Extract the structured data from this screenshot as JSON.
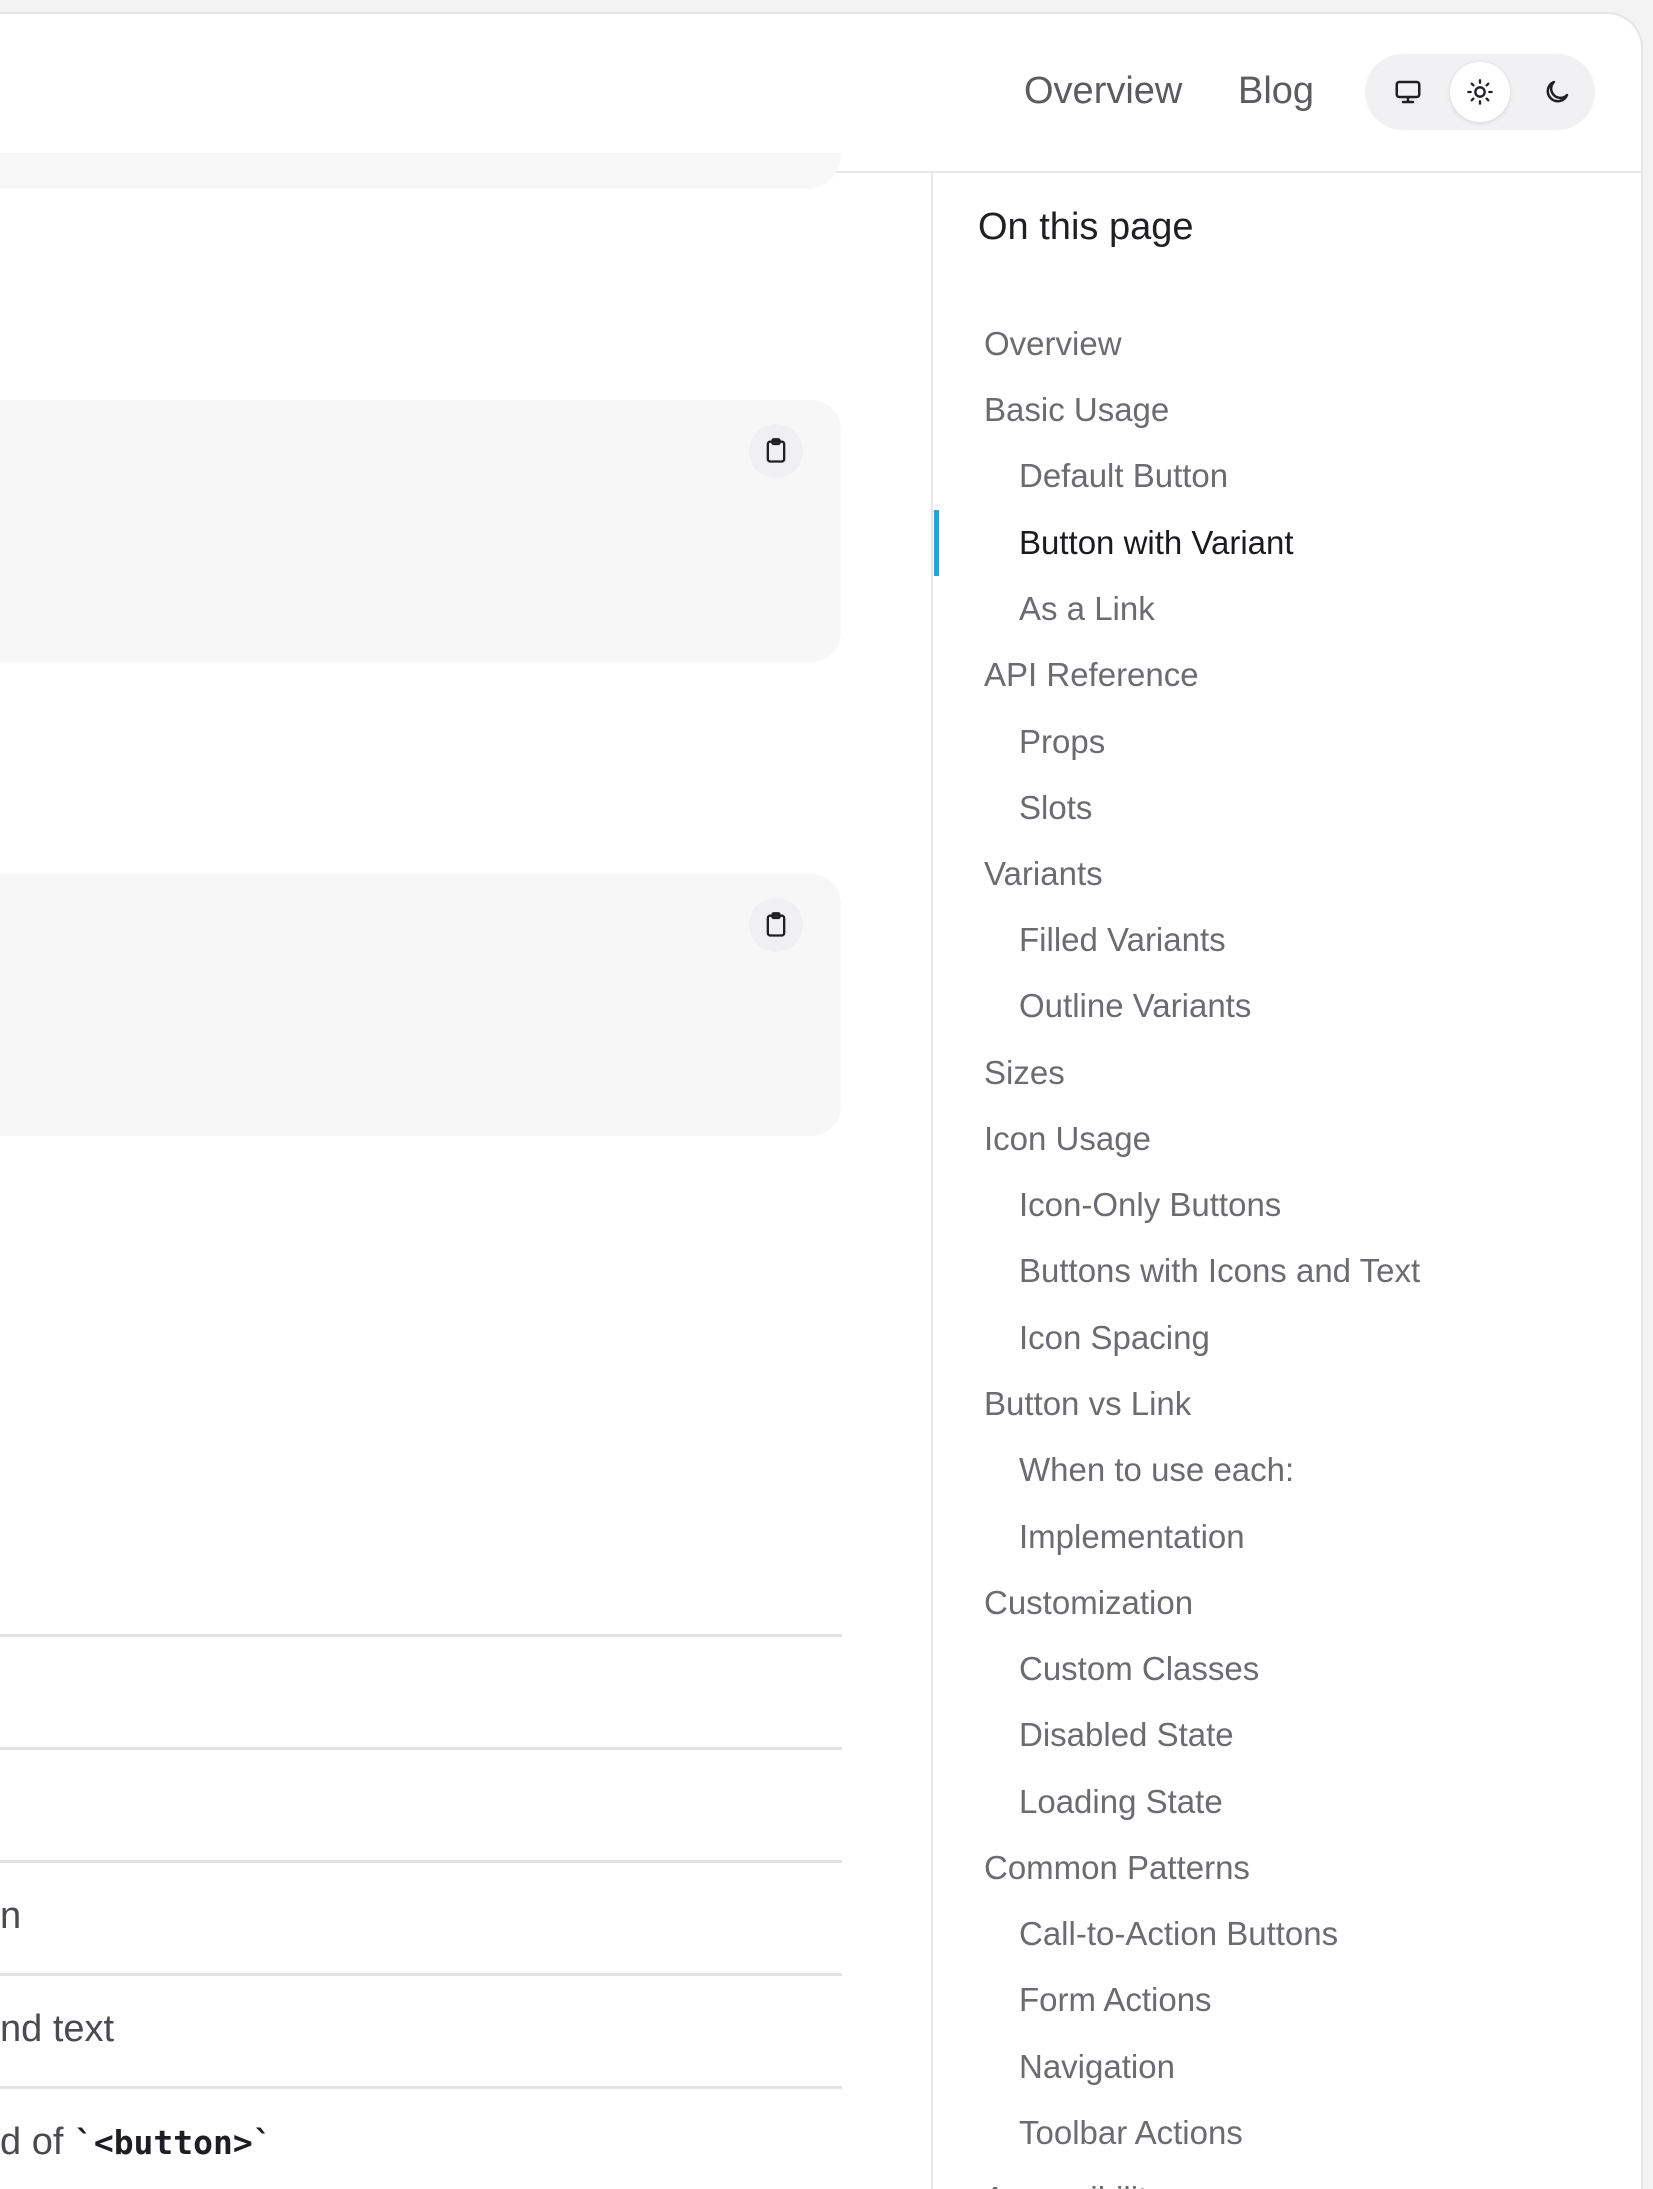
{
  "header": {
    "nav": [
      "Overview",
      "Blog"
    ],
    "theme_options": [
      {
        "icon": "monitor-icon",
        "active": false
      },
      {
        "icon": "sun-icon",
        "active": true
      },
      {
        "icon": "moon-icon",
        "active": false
      }
    ]
  },
  "main": {
    "rows": [
      "",
      "",
      "n",
      "nd text",
      "d of "
    ],
    "row_code": "`<button>`"
  },
  "toc": {
    "title": "On this page",
    "accent_color": "#1ea7e4",
    "items": [
      {
        "label": "Overview",
        "level": 1
      },
      {
        "label": "Basic Usage",
        "level": 1
      },
      {
        "label": "Default Button",
        "level": 2
      },
      {
        "label": "Button with Variant",
        "level": 2,
        "active": true
      },
      {
        "label": "As a Link",
        "level": 2
      },
      {
        "label": "API Reference",
        "level": 1
      },
      {
        "label": "Props",
        "level": 2
      },
      {
        "label": "Slots",
        "level": 2
      },
      {
        "label": "Variants",
        "level": 1
      },
      {
        "label": "Filled Variants",
        "level": 2
      },
      {
        "label": "Outline Variants",
        "level": 2
      },
      {
        "label": "Sizes",
        "level": 1
      },
      {
        "label": "Icon Usage",
        "level": 1
      },
      {
        "label": "Icon-Only Buttons",
        "level": 2
      },
      {
        "label": "Buttons with Icons and Text",
        "level": 2
      },
      {
        "label": "Icon Spacing",
        "level": 2
      },
      {
        "label": "Button vs Link",
        "level": 1
      },
      {
        "label": "When to use each:",
        "level": 2
      },
      {
        "label": "Implementation",
        "level": 2
      },
      {
        "label": "Customization",
        "level": 1
      },
      {
        "label": "Custom Classes",
        "level": 2
      },
      {
        "label": "Disabled State",
        "level": 2
      },
      {
        "label": "Loading State",
        "level": 2
      },
      {
        "label": "Common Patterns",
        "level": 1
      },
      {
        "label": "Call-to-Action Buttons",
        "level": 2
      },
      {
        "label": "Form Actions",
        "level": 2
      },
      {
        "label": "Navigation",
        "level": 2
      },
      {
        "label": "Toolbar Actions",
        "level": 2
      },
      {
        "label": "Accessibility",
        "level": 1
      }
    ]
  }
}
